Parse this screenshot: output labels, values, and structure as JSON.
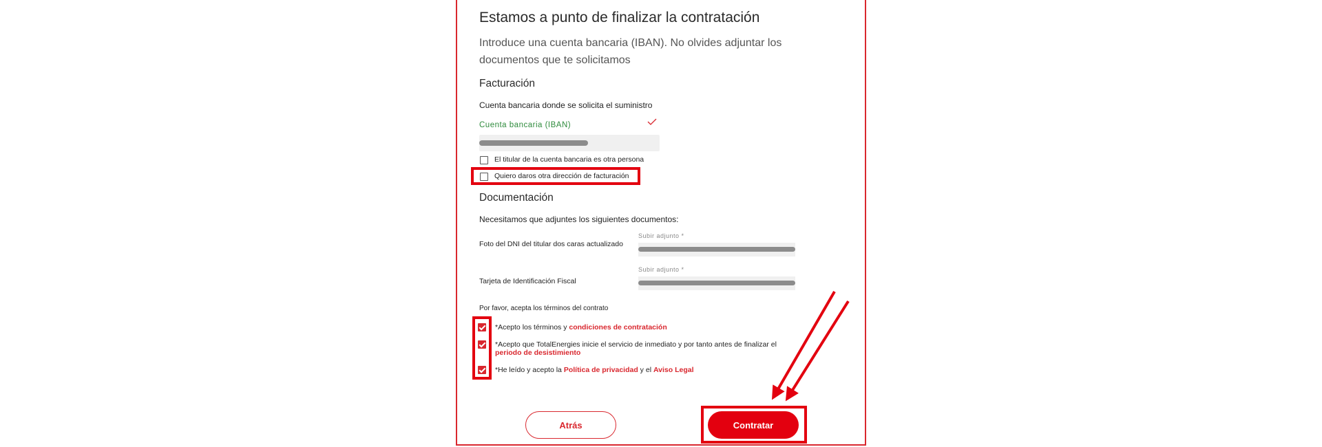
{
  "form": {
    "title": "Estamos a punto de finalizar la contratación",
    "intro": "Introduce una cuenta bancaria (IBAN). No olvides adjuntar los documentos que te solicitamos",
    "billing": {
      "heading": "Facturación",
      "account_label": "Cuenta bancaria donde se solicita el suministro",
      "iban_label": "Cuenta bancaria (IBAN)",
      "holder_other": "El titular de la cuenta bancaria es otra persona",
      "other_address": "Quiero daros otra dirección de facturación"
    },
    "documents": {
      "heading": "Documentación",
      "intro": "Necesitamos que adjuntes los siguientes documentos:",
      "items": [
        {
          "label": "Foto del DNI del titular dos caras actualizado",
          "caption": "Subir adjunto *"
        },
        {
          "label": "Tarjeta de Identificación Fiscal",
          "caption": "Subir adjunto *"
        }
      ]
    },
    "terms": {
      "prompt": "Por favor, acepta los términos del contrato",
      "t1_pre": "*Acepto los términos y ",
      "t1_link": "condiciones de contratación",
      "t2_pre": "*Acepto que TotalEnergies inicie el servicio de inmediato y por tanto antes de finalizar el ",
      "t2_link": "periodo de desistimiento",
      "t3_pre": "*He leído y acepto la ",
      "t3_link1": "Política de privacidad",
      "t3_mid": " y el ",
      "t3_link2": "Aviso Legal"
    },
    "buttons": {
      "back": "Atrás",
      "contract": "Contratar"
    }
  },
  "colors": {
    "brand_red": "#e3000f",
    "valid_green": "#2e8b3c"
  }
}
